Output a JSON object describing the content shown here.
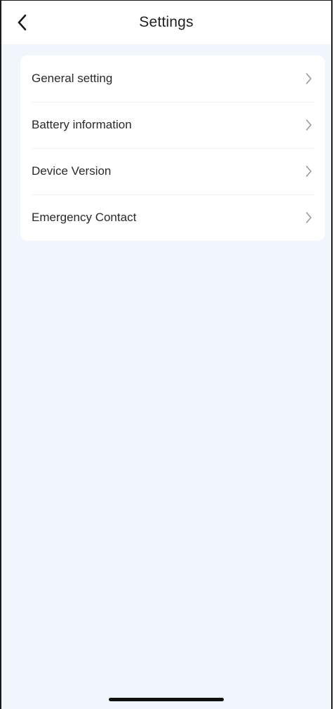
{
  "header": {
    "title": "Settings",
    "back_icon": "chevron-left-icon"
  },
  "settings": {
    "items": [
      {
        "label": "General setting",
        "icon": "chevron-right-icon"
      },
      {
        "label": "Battery information",
        "icon": "chevron-right-icon"
      },
      {
        "label": "Device Version",
        "icon": "chevron-right-icon"
      },
      {
        "label": "Emergency Contact",
        "icon": "chevron-right-icon"
      }
    ]
  },
  "colors": {
    "background": "#f1f6fc",
    "card": "#ffffff",
    "text": "#2a2a2a",
    "chevron": "#9a9a9a"
  }
}
